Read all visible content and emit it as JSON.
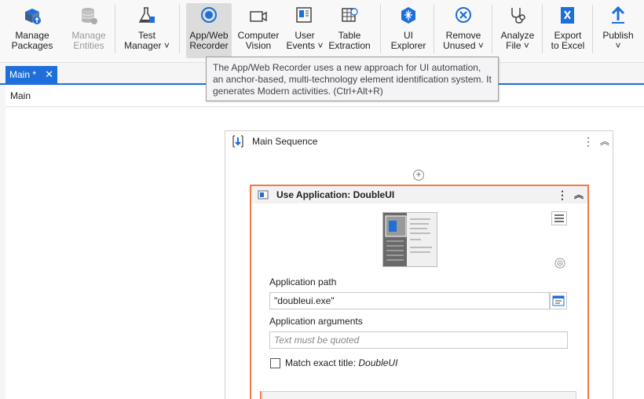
{
  "ribbon": {
    "buttons": [
      {
        "id": "manage-packages",
        "label": "Manage\nPackages"
      },
      {
        "id": "manage-entities",
        "label": "Manage\nEntities"
      },
      {
        "id": "test-manager",
        "label": "Test\nManager ˅"
      },
      {
        "id": "app-web-recorder",
        "label": "App/Web\nRecorder"
      },
      {
        "id": "computer-vision",
        "label": "Computer\nVision"
      },
      {
        "id": "user-events",
        "label": "User\nEvents ˅"
      },
      {
        "id": "table-extraction",
        "label": "Table\nExtraction"
      },
      {
        "id": "ui-explorer",
        "label": "UI\nExplorer"
      },
      {
        "id": "remove-unused",
        "label": "Remove\nUnused ˅"
      },
      {
        "id": "analyze-file",
        "label": "Analyze\nFile ˅"
      },
      {
        "id": "export-to-excel",
        "label": "Export\nto Excel"
      },
      {
        "id": "publish",
        "label": "Publish\n˅"
      }
    ]
  },
  "tabs": [
    {
      "label": "Main *",
      "close": "✕"
    }
  ],
  "breadcrumb": "Main",
  "tooltip": "The App/Web Recorder uses a new approach for UI automation, an anchor-based, multi-technology element identification system. It generates Modern activities. (Ctrl+Alt+R)",
  "sequence": {
    "title": "Main Sequence"
  },
  "use_application": {
    "title": "Use Application: DoubleUI",
    "app_path_label": "Application path",
    "app_path_value": "\"doubleui.exe\"",
    "app_args_label": "Application arguments",
    "app_args_placeholder": "Text must be quoted",
    "match_title_prefix": "Match exact title: ",
    "match_title_name": "DoubleUI",
    "match_title_checked": false
  },
  "colors": {
    "accent": "#1e6fd9",
    "selected_border": "#f07b47",
    "uipath_blue": "#1e6fd9"
  }
}
